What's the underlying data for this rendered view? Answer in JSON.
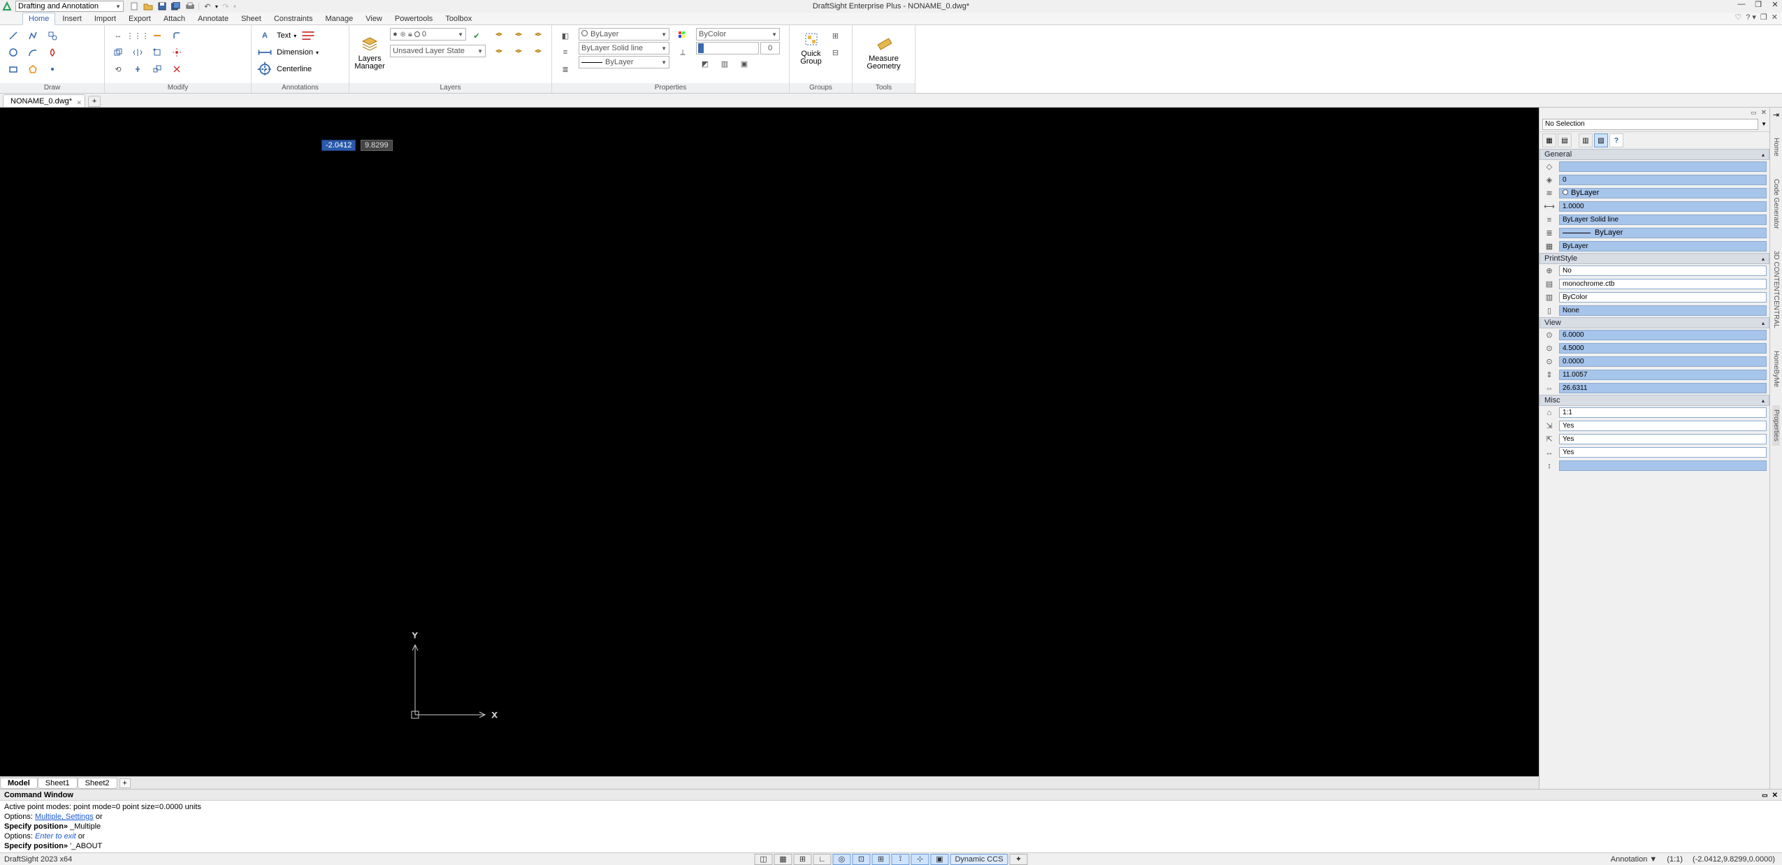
{
  "workspace": "Drafting and Annotation",
  "title": "DraftSight Enterprise Plus - NONAME_0.dwg*",
  "menus": [
    "Home",
    "Insert",
    "Import",
    "Export",
    "Attach",
    "Annotate",
    "Sheet",
    "Constraints",
    "Manage",
    "View",
    "Powertools",
    "Toolbox"
  ],
  "active_menu": "Home",
  "ribbon": {
    "draw_label": "Draw",
    "modify_label": "Modify",
    "annotations_label": "Annotations",
    "layers_label": "Layers",
    "properties_label": "Properties",
    "groups_label": "Groups",
    "tools_label": "Tools",
    "text_btn": "Text",
    "dimension_btn": "Dimension",
    "centerline_btn": "Centerline",
    "layers_manager": "Layers\nManager",
    "layer_state_combo": "Unsaved Layer State",
    "layer_name": "0",
    "linecolor": "ByLayer",
    "linestyle": "ByLayer    Solid line",
    "lineweight": "ByLayer",
    "bycolor": "ByColor",
    "transparency": "0",
    "quick_group": "Quick\nGroup",
    "measure_geom": "Measure\nGeometry"
  },
  "doc_tab": "NONAME_0.dwg*",
  "cursor_coord1": "-2.0412",
  "cursor_coord2": "9.8299",
  "sheet_tabs": [
    "Model",
    "Sheet1",
    "Sheet2"
  ],
  "right_panel": {
    "selection": "No Selection",
    "general_label": "General",
    "printstyle_label": "PrintStyle",
    "view_label": "View",
    "misc_label": "Misc",
    "general": {
      "color": "",
      "layer": "0",
      "linestyle": "ByLayer",
      "scale": "1.0000",
      "pattern": "ByLayer    Solid line",
      "weight_label": "ByLayer",
      "hatch": "ByLayer"
    },
    "printstyle": {
      "p1": "No",
      "p2": "monochrome.ctb",
      "p3": "ByColor",
      "p4": "None"
    },
    "view": {
      "v1": "6.0000",
      "v2": "4.5000",
      "v3": "0.0000",
      "v4": "11.0057",
      "v5": "26.6311"
    },
    "misc": {
      "m1": "1:1",
      "m2": "Yes",
      "m3": "Yes",
      "m4": "Yes",
      "m5": ""
    }
  },
  "side_tabs": [
    "Home",
    "Code Generator",
    "3D CONTENTCENTRAL",
    "HomeByMe",
    "Properties"
  ],
  "cmd_title": "Command Window",
  "cmd": {
    "l0": "Active point modes: point mode=0 point size=0.0000 units",
    "l1a": "Options: ",
    "l1b": "Multiple, Settings",
    "l1c": " or",
    "l2a": "Specify position» ",
    "l2b": "_Multiple",
    "l3a": "Options: ",
    "l3b": "Enter to exit",
    "l3c": " or",
    "l4a": "Specify position» ",
    "l4b": "'_ABOUT"
  },
  "status": {
    "left": "DraftSight 2023 x64",
    "dynamic_ccs": "Dynamic CCS",
    "annotation": "Annotation",
    "scale": "(1:1)",
    "coords": "(-2.0412,9.8299,0.0000)"
  }
}
